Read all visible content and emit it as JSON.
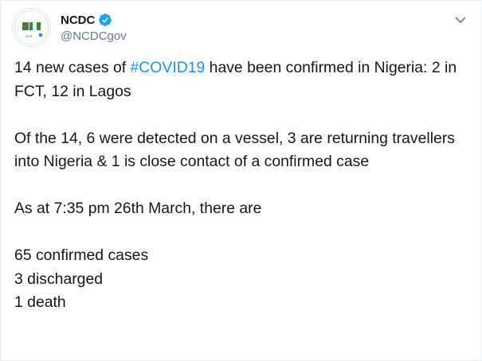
{
  "account": {
    "display_name": "NCDC",
    "handle": "@NCDCgov",
    "verified_icon": "verified-badge-icon",
    "avatar_icon": "ncdc-logo-icon"
  },
  "menu": {
    "caret_icon": "chevron-down-icon"
  },
  "tweet": {
    "p1_before": "14 new cases of ",
    "hashtag": "#COVID19",
    "p1_after": " have been confirmed in Nigeria: 2 in FCT, 12 in Lagos",
    "p2": "Of the 14, 6 were detected on a vessel, 3 are returning travellers into Nigeria & 1 is close contact of a confirmed case",
    "p3": "As at 7:35 pm 26th March, there are",
    "stats": [
      "65 confirmed cases",
      "3 discharged",
      "1 death"
    ]
  },
  "colors": {
    "text": "#14171a",
    "secondary": "#657786",
    "link": "#1b95e0",
    "verified": "#1da1f2"
  }
}
